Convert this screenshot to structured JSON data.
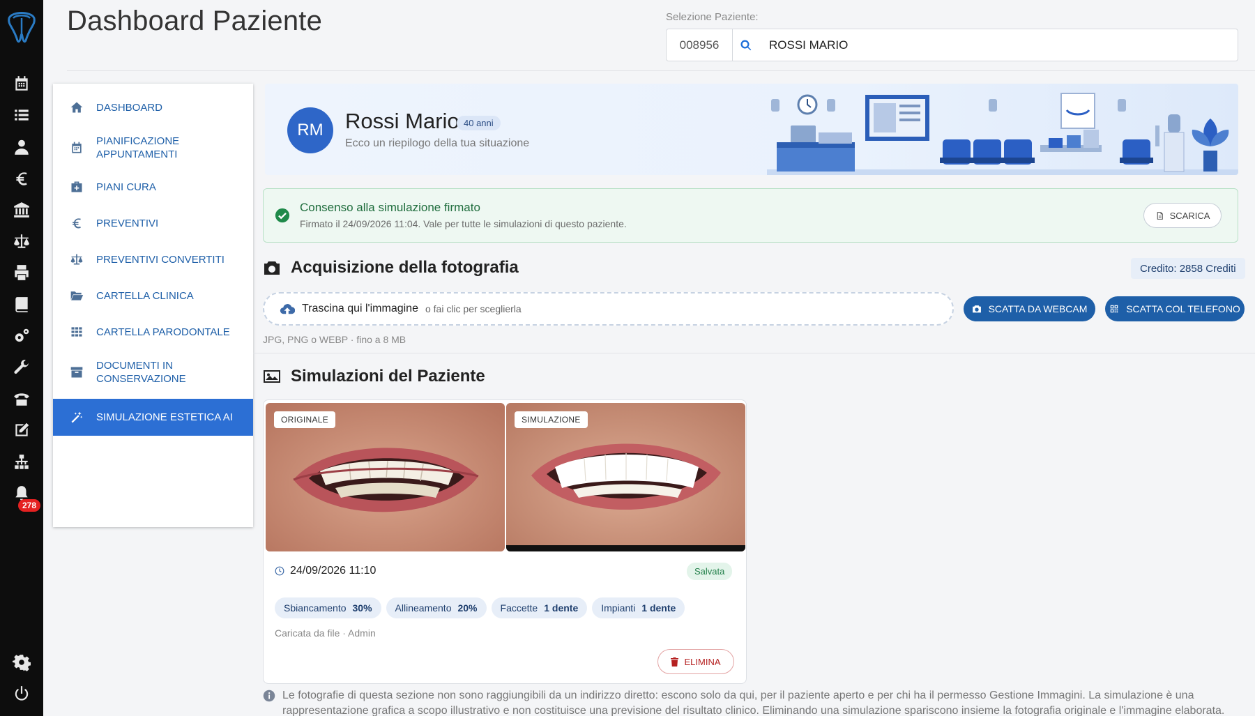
{
  "header": {
    "title": "Dashboard Paziente",
    "patient_select_label": "Selezione Paziente:",
    "patient_code": "008956",
    "patient_name": "ROSSI MARIO"
  },
  "rail": {
    "icons": [
      "tooth-logo-icon",
      "calendar-icon",
      "list-icon",
      "user-doctor-icon",
      "euro-icon",
      "bank-icon",
      "scale-icon",
      "printer-icon",
      "book-icon",
      "gears-icon",
      "wrench-icon",
      "phone-icon",
      "edit-icon",
      "sitemap-icon",
      "bell-icon",
      "settings-icon",
      "power-icon"
    ],
    "notification_count": "278"
  },
  "sidebar": {
    "items": [
      {
        "label": "DASHBOARD",
        "icon": "home-icon"
      },
      {
        "label": "PIANIFICAZIONE APPUNTAMENTI",
        "icon": "calendar-icon"
      },
      {
        "label": "PIANI CURA",
        "icon": "medkit-icon"
      },
      {
        "label": "PREVENTIVI",
        "icon": "euro-icon"
      },
      {
        "label": "PREVENTIVI CONVERTITI",
        "icon": "scale-icon"
      },
      {
        "label": "CARTELLA CLINICA",
        "icon": "folder-open-icon"
      },
      {
        "label": "CARTELLA PARODONTALE",
        "icon": "grid-icon"
      },
      {
        "label": "DOCUMENTI IN CONSERVAZIONE",
        "icon": "archive-icon"
      },
      {
        "label": "SIMULAZIONE ESTETICA AI",
        "icon": "magic-wand-icon",
        "active": true
      }
    ]
  },
  "patient": {
    "initials": "RM",
    "name": "Rossi Mario",
    "age": "40 anni",
    "subtitle": "Ecco un riepilogo della tua situazione"
  },
  "consent": {
    "title": "Consenso alla simulazione firmato",
    "detail": "Firmato il 24/09/2026 11:04. Vale per tutte le simulazioni di questo paziente.",
    "download_label": "SCARICA"
  },
  "acquisition": {
    "title": "Acquisizione della fotografia",
    "credit": "Credito: 2858 Crediti",
    "drop_main": "Trascina qui l'immagine",
    "drop_sub": "o fai clic per sceglierla",
    "webcam_label": "SCATTA DA WEBCAM",
    "phone_label": "SCATTA COL TELEFONO",
    "formats": "JPG, PNG o WEBP · fino a 8 MB"
  },
  "simulations": {
    "title": "Simulazioni del Paziente",
    "items": [
      {
        "original_tag": "ORIGINALE",
        "simulation_tag": "SIMULAZIONE",
        "date": "24/09/2026 11:10",
        "status": "Salvata",
        "chips": [
          {
            "label": "Sbiancamento",
            "value": "30%"
          },
          {
            "label": "Allineamento",
            "value": "20%"
          },
          {
            "label": "Faccette",
            "value": "1 dente"
          },
          {
            "label": "Impianti",
            "value": "1 dente"
          }
        ],
        "uploaded_by": "Caricata da file · Admin",
        "delete_label": "ELIMINA"
      }
    ]
  },
  "note": "Le fotografie di questa sezione non sono raggiungibili da un indirizzo diretto: escono solo da qui, per il paziente aperto e per chi ha il permesso Gestione Immagini. La simulazione è una rappresentazione grafica a scopo illustrativo e non costituisce una previsione del risultato clinico. Eliminando una simulazione spariscono insieme la fotografia originale e l'immagine elaborata.",
  "colors": {
    "accent": "#1e5fa8",
    "active_menu": "#2c6fd4",
    "success": "#1f6d3d",
    "danger": "#b52020",
    "rail": "#0d0d0d"
  }
}
